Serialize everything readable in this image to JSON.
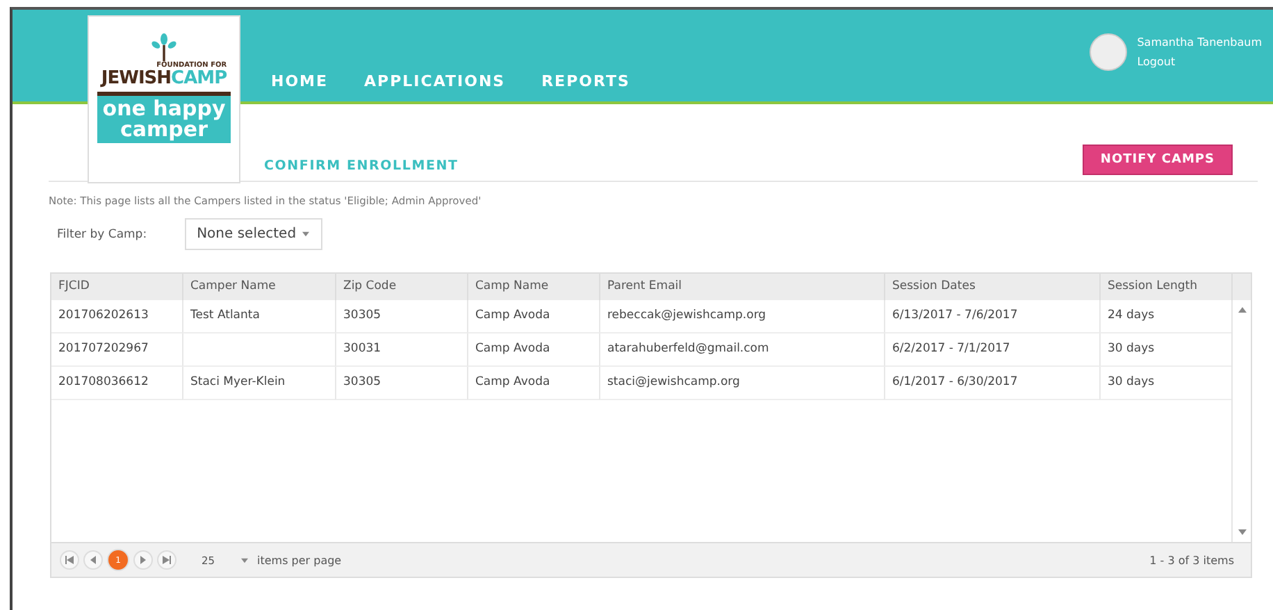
{
  "logo": {
    "foundation": "FOUNDATION FOR",
    "brand_left": "JEW",
    "brand_mid": "I",
    "brand_right": "SH",
    "brand_camp": "CAMP",
    "tagline_1": "one",
    "tagline_2": "happy",
    "tagline_3": "camper"
  },
  "nav": [
    {
      "label": "HOME"
    },
    {
      "label": "APPLICATIONS"
    },
    {
      "label": "REPORTS"
    }
  ],
  "user": {
    "name": "Samantha Tanenbaum",
    "logout": "Logout"
  },
  "page_title": "CONFIRM ENROLLMENT",
  "notify_button": "NOTIFY CAMPS",
  "note": "Note: This page lists all the Campers listed in the status 'Eligible; Admin Approved'",
  "filter": {
    "label": "Filter by Camp:",
    "value": "None selected"
  },
  "table": {
    "columns": [
      "FJCID",
      "Camper Name",
      "Zip Code",
      "Camp Name",
      "Parent Email",
      "Session Dates",
      "Session Length"
    ],
    "rows": [
      [
        "201706202613",
        "Test Atlanta",
        "30305",
        "Camp Avoda",
        "rebeccak@jewishcamp.org",
        "6/13/2017 - 7/6/2017",
        "24 days"
      ],
      [
        "201707202967",
        "",
        "30031",
        "Camp Avoda",
        "atarahuberfeld@gmail.com",
        "6/2/2017 - 7/1/2017",
        "30 days"
      ],
      [
        "201708036612",
        "Staci Myer-Klein",
        "30305",
        "Camp Avoda",
        "staci@jewishcamp.org",
        "6/1/2017 - 6/30/2017",
        "30 days"
      ]
    ]
  },
  "pager": {
    "pages": [
      {
        "label": "1",
        "selected": true
      }
    ],
    "page_size": "25",
    "page_size_label": "items per page",
    "summary": "1 - 3 of 3 items"
  }
}
